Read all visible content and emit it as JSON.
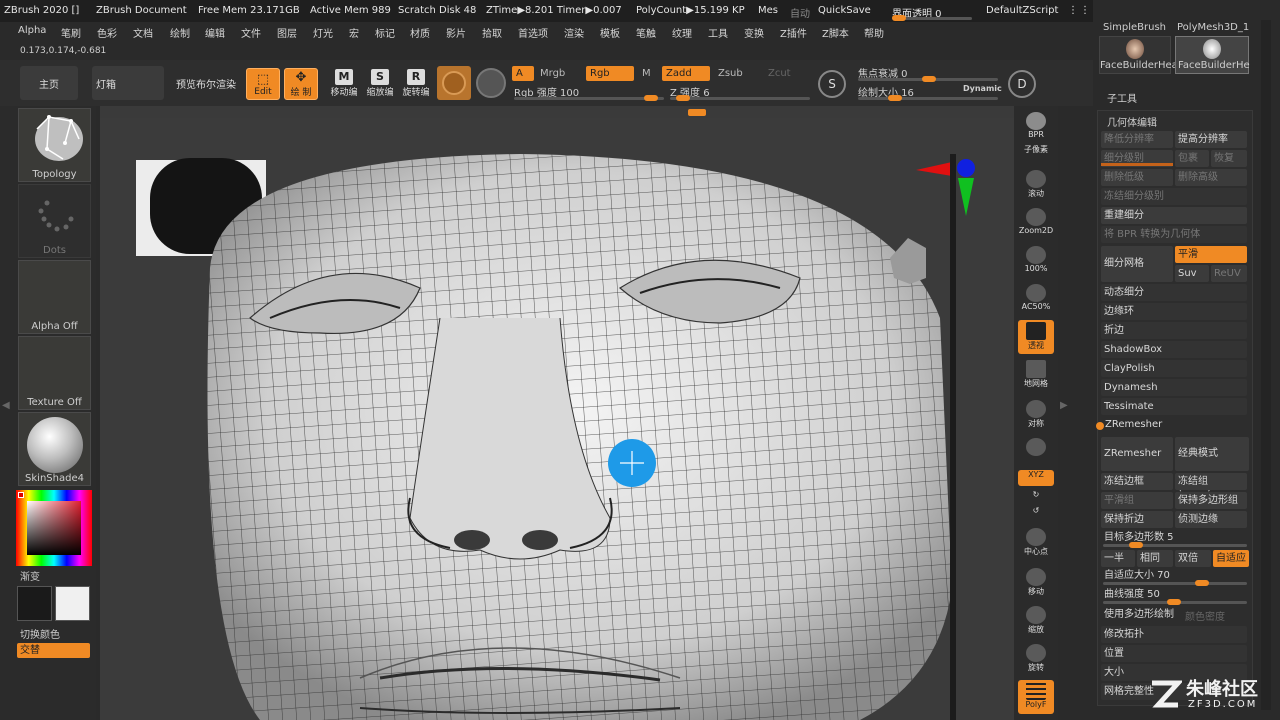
{
  "titlebar": {
    "items": [
      "ZBrush 2020 []",
      "ZBrush Document",
      "Free Mem 23.171GB",
      "Active Mem 989",
      "Scratch Disk 48",
      "ZTime▶8.201 Timer▶0.007",
      "PolyCount▶15.199 KP",
      "Mes"
    ],
    "autosave": "自动",
    "quicksave": "QuickSave",
    "transparency": "界面透明 0",
    "script": "DefaultZScript"
  },
  "menu": [
    "Alpha",
    "笔刷",
    "色彩",
    "文档",
    "绘制",
    "编辑",
    "文件",
    "图层",
    "灯光",
    "宏",
    "标记",
    "材质",
    "影片",
    "拾取",
    "首选项",
    "渲染",
    "模板",
    "笔触",
    "纹理",
    "工具",
    "变换",
    "Z插件",
    "Z脚本",
    "帮助"
  ],
  "coords": "0.173,0.174,-0.681",
  "toolbar": {
    "home": "主页",
    "lightbox": "灯箱",
    "preview": "预览布尔渲染",
    "edit": "Edit",
    "draw": "绘 制",
    "move": "移动编",
    "scale": "缩放编",
    "rotate": "旋转编",
    "a": "A",
    "mrgb": "Mrgb",
    "rgb": "Rgb",
    "m": "M",
    "zadd": "Zadd",
    "zsub": "Zsub",
    "zcut": "Zcut",
    "rgb_intensity": "Rgb 强度 100",
    "z_intensity": "Z 强度 6",
    "focal": "焦点衰减 0",
    "draw_size": "绘制大小 16",
    "dynamic": "Dynamic",
    "s_label": "S",
    "d_label": "D"
  },
  "left_panel": {
    "topology": "Topology",
    "dots": "Dots",
    "alpha": "Alpha Off",
    "texture": "Texture Off",
    "material": "SkinShade4",
    "gradient": "渐变",
    "switch_color": "切换颜色",
    "alternate": "交替"
  },
  "dock": {
    "bpr": "BPR",
    "subpixel": "子像素",
    "scroll": "滚动",
    "zoom2d": "Zoom2D",
    "z100": "100%",
    "ac50": "AC50%",
    "persp": "透视",
    "floor": "地网格",
    "sym": "对称",
    "xyz": "XYZ",
    "center": "中心点",
    "move": "移动",
    "scale": "缩放",
    "rotate": "旋转",
    "polyf": "PolyF"
  },
  "right_panel": {
    "brushes": [
      "SimpleBrush",
      "PolyMesh3D_1",
      "FaceBuilderHea",
      "FaceBuilderHe"
    ],
    "subtool": "子工具",
    "geometry": "几何体编辑",
    "lower_res": "降低分辨率",
    "higher_res": "提高分辨率",
    "sdiv": "细分级别",
    "del_lower": "删除低级",
    "del_higher": "删除高级",
    "freeze_sdiv": "冻结细分级别",
    "rebuild": "重建细分",
    "bpr_geom": "将 BPR 转换为几何体",
    "divide": "细分网格",
    "smooth": "平滑",
    "suv": "Suv",
    "reuv": "ReUV",
    "install": "包裹",
    "restore": "恢复",
    "dynamic_sub": "动态细分",
    "edge_loop": "边缘环",
    "crease": "折边",
    "shadowbox": "ShadowBox",
    "claypolish": "ClayPolish",
    "dynamesh": "Dynamesh",
    "tessimate": "Tessimate",
    "zremesher_title": "ZRemesher",
    "zremesher_btn": "ZRemesher",
    "legacy": "经典模式(2018)",
    "freeze_border": "冻结边框",
    "freeze_groups": "冻结组",
    "smooth_groups": "平滑组",
    "keep_groups": "保持多边形组",
    "keep_creases": "保持折边",
    "detect_edges": "侦测边缘",
    "target_poly": "目标多边形数 5",
    "half": "一半",
    "same": "相同",
    "double": "双倍",
    "adaptive": "自适应",
    "adaptive_size": "自适应大小 70",
    "curve_strength": "曲线强度 50",
    "use_polypaint": "使用多边形绘制",
    "color_density": "颜色密度",
    "modify_topo": "修改拓扑",
    "position": "位置",
    "size": "大小",
    "mesh_integrity": "网格完整性"
  },
  "watermark": {
    "brand": "朱峰社区",
    "url": "ZF3D.COM"
  }
}
